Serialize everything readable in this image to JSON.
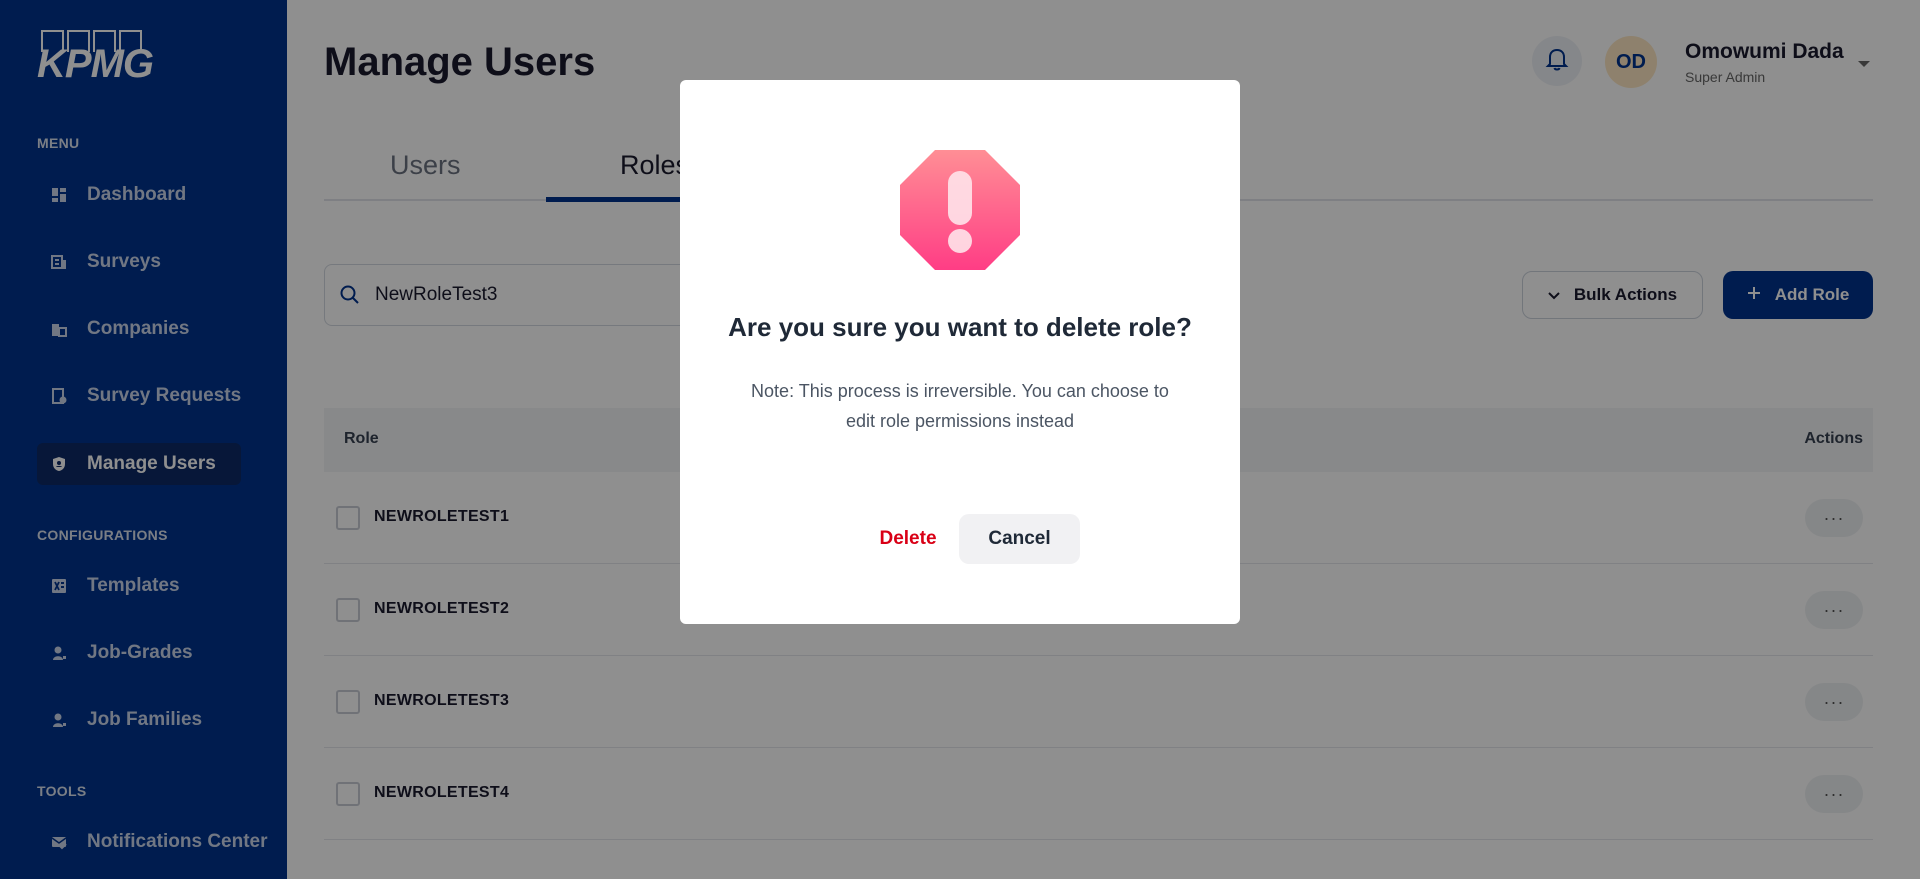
{
  "brand": {
    "logo_text": "KPMG",
    "primary_color": "#00338d"
  },
  "sidebar": {
    "menu_label": "MENU",
    "menu_items": [
      {
        "label": "Dashboard",
        "icon": "dashboard-icon"
      },
      {
        "label": "Surveys",
        "icon": "survey-icon"
      },
      {
        "label": "Companies",
        "icon": "companies-icon"
      },
      {
        "label": "Survey Requests",
        "icon": "survey-requests-icon"
      },
      {
        "label": "Manage Users",
        "icon": "shield-icon",
        "active": true
      }
    ],
    "config_label": "CONFIGURATIONS",
    "config_items": [
      {
        "label": "Templates",
        "icon": "excel-icon"
      },
      {
        "label": "Job-Grades",
        "icon": "person-icon"
      },
      {
        "label": "Job Families",
        "icon": "person-icon"
      }
    ],
    "tools_label": "TOOLS",
    "tools_items": [
      {
        "label": "Notifications Center",
        "icon": "mail-check-icon"
      }
    ]
  },
  "header": {
    "title": "Manage Users",
    "user": {
      "initials": "OD",
      "name": "Omowumi Dada",
      "role": "Super Admin"
    }
  },
  "tabs": [
    {
      "label": "Users"
    },
    {
      "label": "Roles",
      "active": true
    }
  ],
  "search": {
    "value": "NewRoleTest3"
  },
  "toolbar": {
    "bulk_label": "Bulk Actions",
    "add_label": "Add Role"
  },
  "table": {
    "columns": {
      "role": "Role",
      "actions": "Actions"
    },
    "rows": [
      {
        "name": "NEWROLETEST1"
      },
      {
        "name": "NEWROLETEST2"
      },
      {
        "name": "NEWROLETEST3"
      },
      {
        "name": "NEWROLETEST4"
      }
    ],
    "more_glyph": "···"
  },
  "modal": {
    "title": "Are you sure you want to delete role?",
    "note": "Note: This process is irreversible. You can choose to edit role permissions instead",
    "delete_label": "Delete",
    "cancel_label": "Cancel",
    "danger_color": "#d90016",
    "icon": "warning-octagon-icon"
  }
}
